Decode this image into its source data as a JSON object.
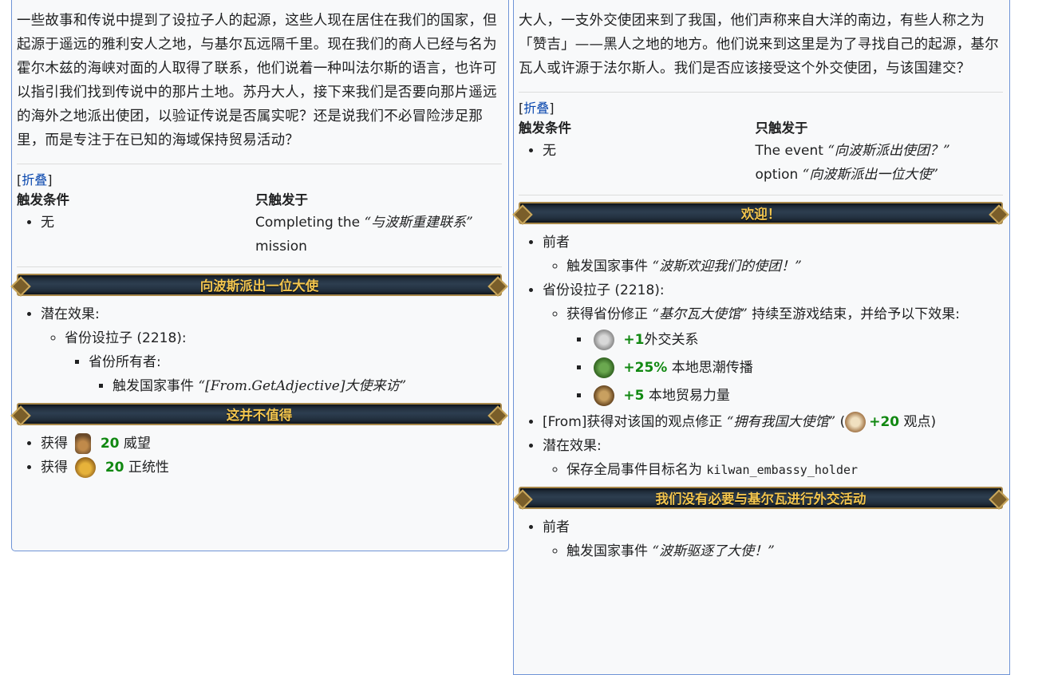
{
  "left": {
    "description": "一些故事和传说中提到了设拉子人的起源，这些人现在居住在我们的国家，但起源于遥远的雅利安人之地，与基尔瓦远隔千里。现在我们的商人已经与名为霍尔木兹的海峡对面的人取得了联系，他们说着一种叫法尔斯的语言，也许可以指引我们找到传说中的那片土地。苏丹大人，接下来我们是否要向那片遥远的海外之地派出使团，以验证传说是否属实呢？还是说我们不必冒险涉足那里，而是专注于在已知的海域保持贸易活动？",
    "collapse": "折叠",
    "trigger_title": "触发条件",
    "trigger_value": "无",
    "only_title": "只触发于",
    "only_prefix": "Completing the",
    "only_quote": "“与波斯重建联系”",
    "only_suffix": "mission",
    "option1": {
      "title": "向波斯派出一位大使",
      "potential": "潜在效果:",
      "province": "省份设拉子 (2218):",
      "owner": "省份所有者:",
      "event_label": "触发国家事件",
      "event_name": "“[From.GetAdjective]大使来访”"
    },
    "option2": {
      "title": "这并不值得",
      "gain1_label": "获得",
      "gain1_value": "20",
      "gain1_name": "威望",
      "gain2_label": "获得",
      "gain2_value": "20",
      "gain2_name": "正统性"
    }
  },
  "right": {
    "description": "大人，一支外交使团来到了我国，他们声称来自大洋的南边，有些人称之为「赞吉」——黑人之地的地方。他们说来到这里是为了寻找自己的起源，基尔瓦人或许源于法尔斯人。我们是否应该接受这个外交使团，与该国建交？",
    "collapse": "折叠",
    "trigger_title": "触发条件",
    "trigger_value": "无",
    "only_title": "只触发于",
    "only_prefix": "The event",
    "only_event": "“向波斯派出使团？”",
    "only_mid": "option",
    "only_option": "“向波斯派出一位大使”",
    "option1": {
      "title": "欢迎！",
      "former": "前者",
      "event_label": "触发国家事件",
      "event_name": "“波斯欢迎我们的使团！”",
      "province": "省份设拉子 (2218):",
      "modifier_label": "获得省份修正",
      "modifier_name": "“基尔瓦大使馆”",
      "modifier_suffix": "持续至游戏结束，并给予以下效果:",
      "effect1_value": "+1",
      "effect1_name": "外交关系",
      "effect2_value": "+25%",
      "effect2_name": "本地思潮传播",
      "effect3_value": "+5",
      "effect3_name": "本地贸易力量",
      "opinion_prefix": "[From]获得对该国的观点修正",
      "opinion_name": "“拥有我国大使馆”",
      "opinion_open": "(",
      "opinion_value": "+20",
      "opinion_unit": "观点",
      "opinion_close": ")",
      "potential": "潜在效果:",
      "save_label": "保存全局事件目标名为",
      "save_target": "kilwan_embassy_holder"
    },
    "option2": {
      "title": "我们没有必要与基尔瓦进行外交活动",
      "former": "前者",
      "event_label": "触发国家事件",
      "event_name": "“波斯驱逐了大使！”"
    }
  },
  "colors": {
    "panel_border": "#6f94d6",
    "link": "#0645ad",
    "positive": "#118811",
    "banner_text": "#f2c54f"
  }
}
